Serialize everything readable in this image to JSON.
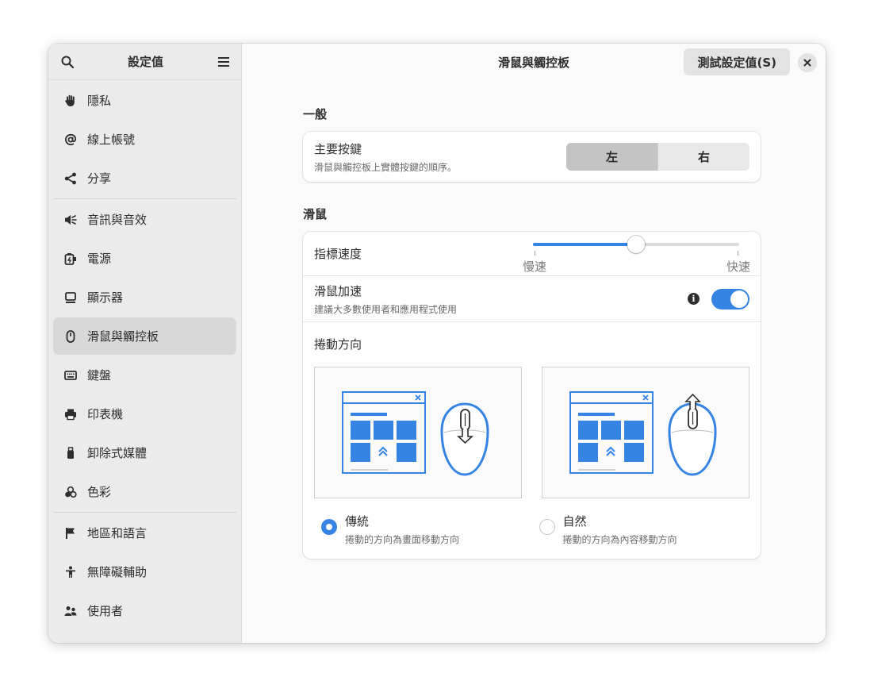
{
  "sidebar": {
    "title": "設定值",
    "items": [
      {
        "label": "隱私",
        "icon": "hand-icon"
      },
      {
        "label": "線上帳號",
        "icon": "at-icon"
      },
      {
        "label": "分享",
        "icon": "share-icon"
      },
      {
        "label": "音訊與音效",
        "icon": "speaker-icon"
      },
      {
        "label": "電源",
        "icon": "power-plug-icon"
      },
      {
        "label": "顯示器",
        "icon": "display-icon"
      },
      {
        "label": "滑鼠與觸控板",
        "icon": "mouse-icon",
        "active": true
      },
      {
        "label": "鍵盤",
        "icon": "keyboard-icon"
      },
      {
        "label": "印表機",
        "icon": "printer-icon"
      },
      {
        "label": "卸除式媒體",
        "icon": "usb-icon"
      },
      {
        "label": "色彩",
        "icon": "color-icon"
      },
      {
        "label": "地區和語言",
        "icon": "flag-icon"
      },
      {
        "label": "無障礙輔助",
        "icon": "accessibility-icon"
      },
      {
        "label": "使用者",
        "icon": "users-icon"
      }
    ]
  },
  "header": {
    "title": "滑鼠與觸控板",
    "test_button": "測試設定值(S)"
  },
  "general": {
    "section_title": "一般",
    "primary_button": {
      "title": "主要按鍵",
      "subtitle": "滑鼠與觸控板上實體按鍵的順序。",
      "left": "左",
      "right": "右",
      "selected": "左"
    }
  },
  "mouse": {
    "section_title": "滑鼠",
    "pointer_speed": {
      "title": "指標速度",
      "min_label": "慢速",
      "max_label": "快速",
      "value": 0.5
    },
    "acceleration": {
      "title": "滑鼠加速",
      "subtitle": "建議大多數使用者和應用程式使用",
      "enabled": true
    },
    "scroll": {
      "title": "捲動方向",
      "traditional": {
        "title": "傳統",
        "subtitle": "捲動的方向為畫面移動方向",
        "selected": true
      },
      "natural": {
        "title": "自然",
        "subtitle": "捲動的方向為內容移動方向",
        "selected": false
      }
    }
  },
  "colors": {
    "accent": "#3584e4",
    "illustration": "#3584e4"
  }
}
